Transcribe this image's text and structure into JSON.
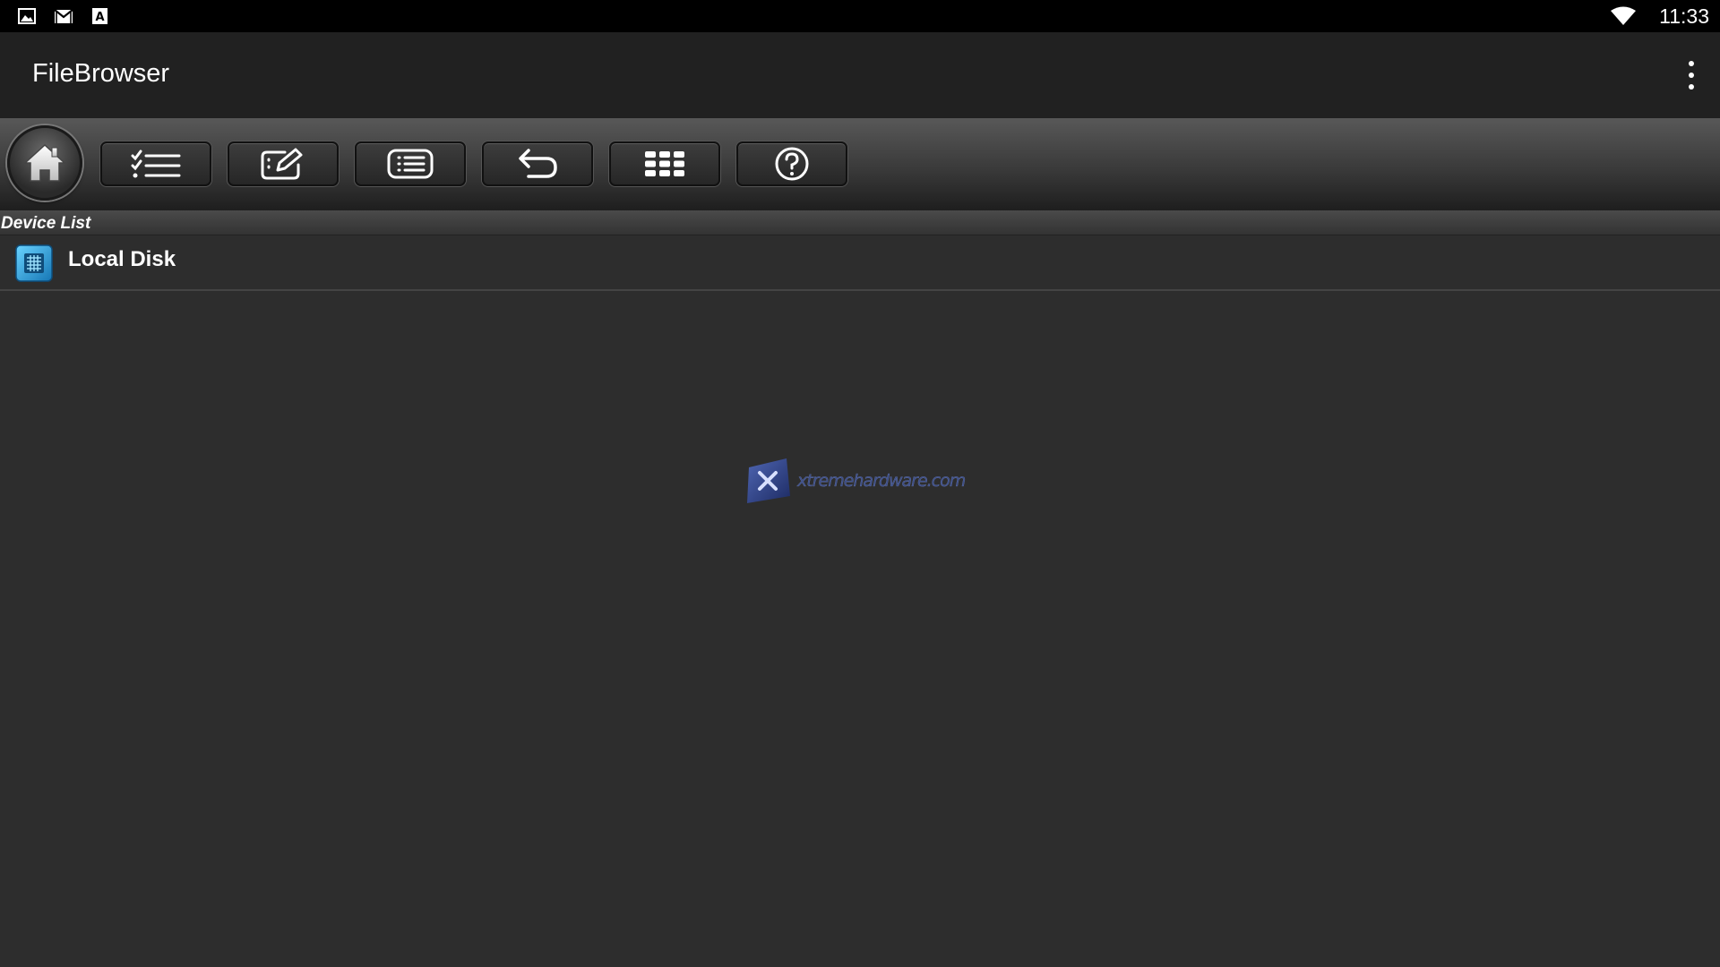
{
  "status_bar": {
    "time": "11:33",
    "notification_icons": [
      "image-icon",
      "gmail-icon",
      "keyboard-a-icon"
    ],
    "wifi_icon": "wifi-icon"
  },
  "app_bar": {
    "title": "FileBrowser",
    "menu_icon": "overflow-menu-icon"
  },
  "toolbar": {
    "buttons": [
      {
        "name": "home",
        "icon": "home-icon"
      },
      {
        "name": "multi-select",
        "icon": "checklist-icon"
      },
      {
        "name": "edit",
        "icon": "edit-icon"
      },
      {
        "name": "list-view",
        "icon": "list-icon"
      },
      {
        "name": "back",
        "icon": "undo-arrow-icon"
      },
      {
        "name": "grid-view",
        "icon": "grid-icon"
      },
      {
        "name": "help",
        "icon": "help-icon"
      }
    ]
  },
  "section": {
    "title": "Device List"
  },
  "devices": [
    {
      "label": "Local Disk",
      "icon": "local-disk-icon"
    }
  ],
  "watermark": {
    "text": "xtremehardware.com"
  },
  "colors": {
    "status_bar": "#000000",
    "app_bar": "#212121",
    "background": "#2d2d2d",
    "disk_icon": "#2a9fd6",
    "watermark": "#3d4e86"
  }
}
